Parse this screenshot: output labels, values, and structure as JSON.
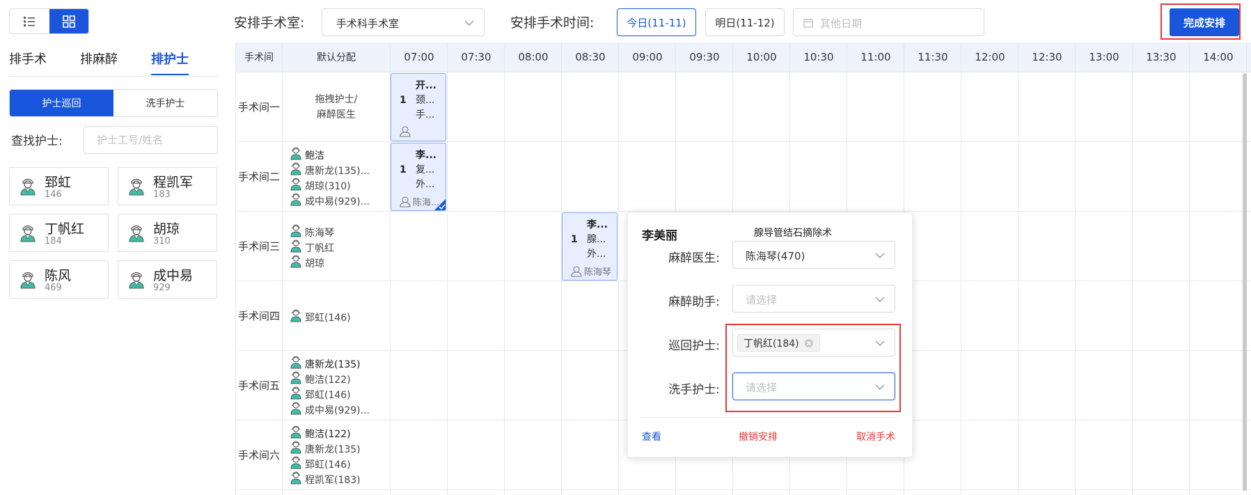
{
  "left": {
    "tabs": [
      "排手术",
      "排麻醉",
      "排护士"
    ],
    "sub_tabs": [
      "护士巡回",
      "洗手护士"
    ],
    "search_label": "查找护士:",
    "search_placeholder": "护士工号/姓名",
    "nurses": [
      {
        "name": "郅虹",
        "id": "146"
      },
      {
        "name": "程凯军",
        "id": "183"
      },
      {
        "name": "丁帆红",
        "id": "184"
      },
      {
        "name": "胡琼",
        "id": "310"
      },
      {
        "name": "陈风",
        "id": "469"
      },
      {
        "name": "成中易",
        "id": "929"
      }
    ]
  },
  "topbar": {
    "room_label": "安排手术室:",
    "room_value": "手术科手术室",
    "time_label": "安排手术时间:",
    "today": "今日(11-11)",
    "tomorrow": "明日(11-12)",
    "other_date_placeholder": "其他日期",
    "complete": "完成安排"
  },
  "grid": {
    "col_room": "手术间",
    "col_default": "默认分配",
    "times": [
      "07:00",
      "07:30",
      "08:00",
      "08:30",
      "09:00",
      "09:30",
      "10:00",
      "10:30",
      "11:00",
      "11:30",
      "12:00",
      "12:30",
      "13:00",
      "13:30",
      "14:00"
    ],
    "rooms": [
      {
        "name": "手术间一",
        "hint": [
          "拖拽护士/",
          "麻醉医生"
        ],
        "people": []
      },
      {
        "name": "手术间二",
        "people": [
          {
            "t": "鲍洁",
            "bold": true
          },
          {
            "t": "唐新龙(135)..."
          },
          {
            "t": "胡琼(310)"
          },
          {
            "t": "成中易(929)..."
          }
        ]
      },
      {
        "name": "手术间三",
        "people": [
          {
            "t": "陈海琴"
          },
          {
            "t": "丁帆红"
          },
          {
            "t": "胡琼"
          }
        ]
      },
      {
        "name": "手术间四",
        "people": [
          {
            "t": "郅虹(146)"
          }
        ]
      },
      {
        "name": "手术间五",
        "people": [
          {
            "t": "唐新龙(135)",
            "bold": true
          },
          {
            "t": "鲍洁(122)"
          },
          {
            "t": "郅虹(146)"
          },
          {
            "t": "成中易(929)..."
          }
        ]
      },
      {
        "name": "手术间六",
        "people": [
          {
            "t": "鲍洁(122)",
            "bold": true
          },
          {
            "t": "唐新龙(135)"
          },
          {
            "t": "郅虹(146)"
          },
          {
            "t": "程凯军(183)"
          }
        ]
      }
    ],
    "surgeries": [
      {
        "num": "1",
        "l1": "开...",
        "l2": "颈...",
        "l3": "手...",
        "bottom": ""
      },
      {
        "num": "1",
        "l1": "李...",
        "l2": "复...",
        "l3": "外...",
        "bottom": "陈海..."
      },
      {
        "num": "1",
        "l1": "李...",
        "l2": "腺...",
        "l3": "外...",
        "bottom": "陈海琴"
      }
    ]
  },
  "popover": {
    "patient": "李美丽",
    "operation": "腺导管结石摘除术",
    "anesth_label": "麻醉医生:",
    "anesth_value": "陈海琴(470)",
    "assist_label": "麻醉助手:",
    "assist_placeholder": "请选择",
    "circ_label": "巡回护士:",
    "circ_tag": "丁帆红(184)",
    "scrub_label": "洗手护士:",
    "scrub_placeholder": "请选择",
    "view": "查看",
    "undo": "撤销安排",
    "cancel": "取消手术"
  },
  "colors": {
    "primary": "#1a56db",
    "danger": "#e53935",
    "nurse_icon": "#3bbfa8"
  }
}
